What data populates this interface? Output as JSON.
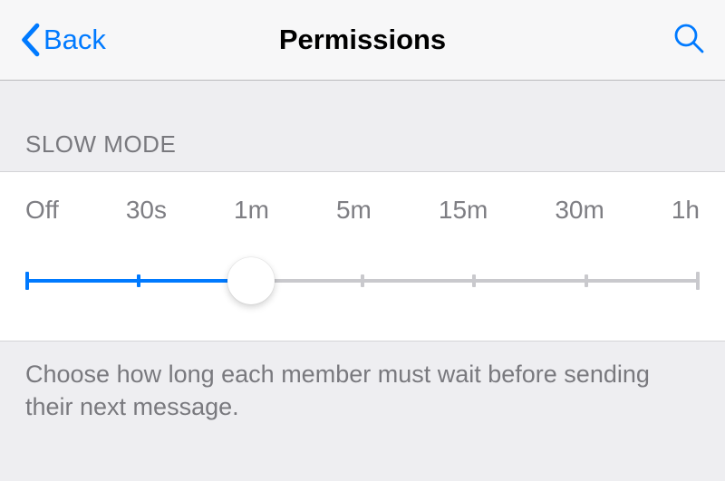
{
  "nav": {
    "back_label": "Back",
    "title": "Permissions"
  },
  "section": {
    "header": "SLOW MODE",
    "footer": "Choose how long each member must wait before sending their next message."
  },
  "slider": {
    "options": [
      "Off",
      "30s",
      "1m",
      "5m",
      "15m",
      "30m",
      "1h"
    ],
    "selected_index": 2
  },
  "colors": {
    "accent": "#007aff"
  }
}
